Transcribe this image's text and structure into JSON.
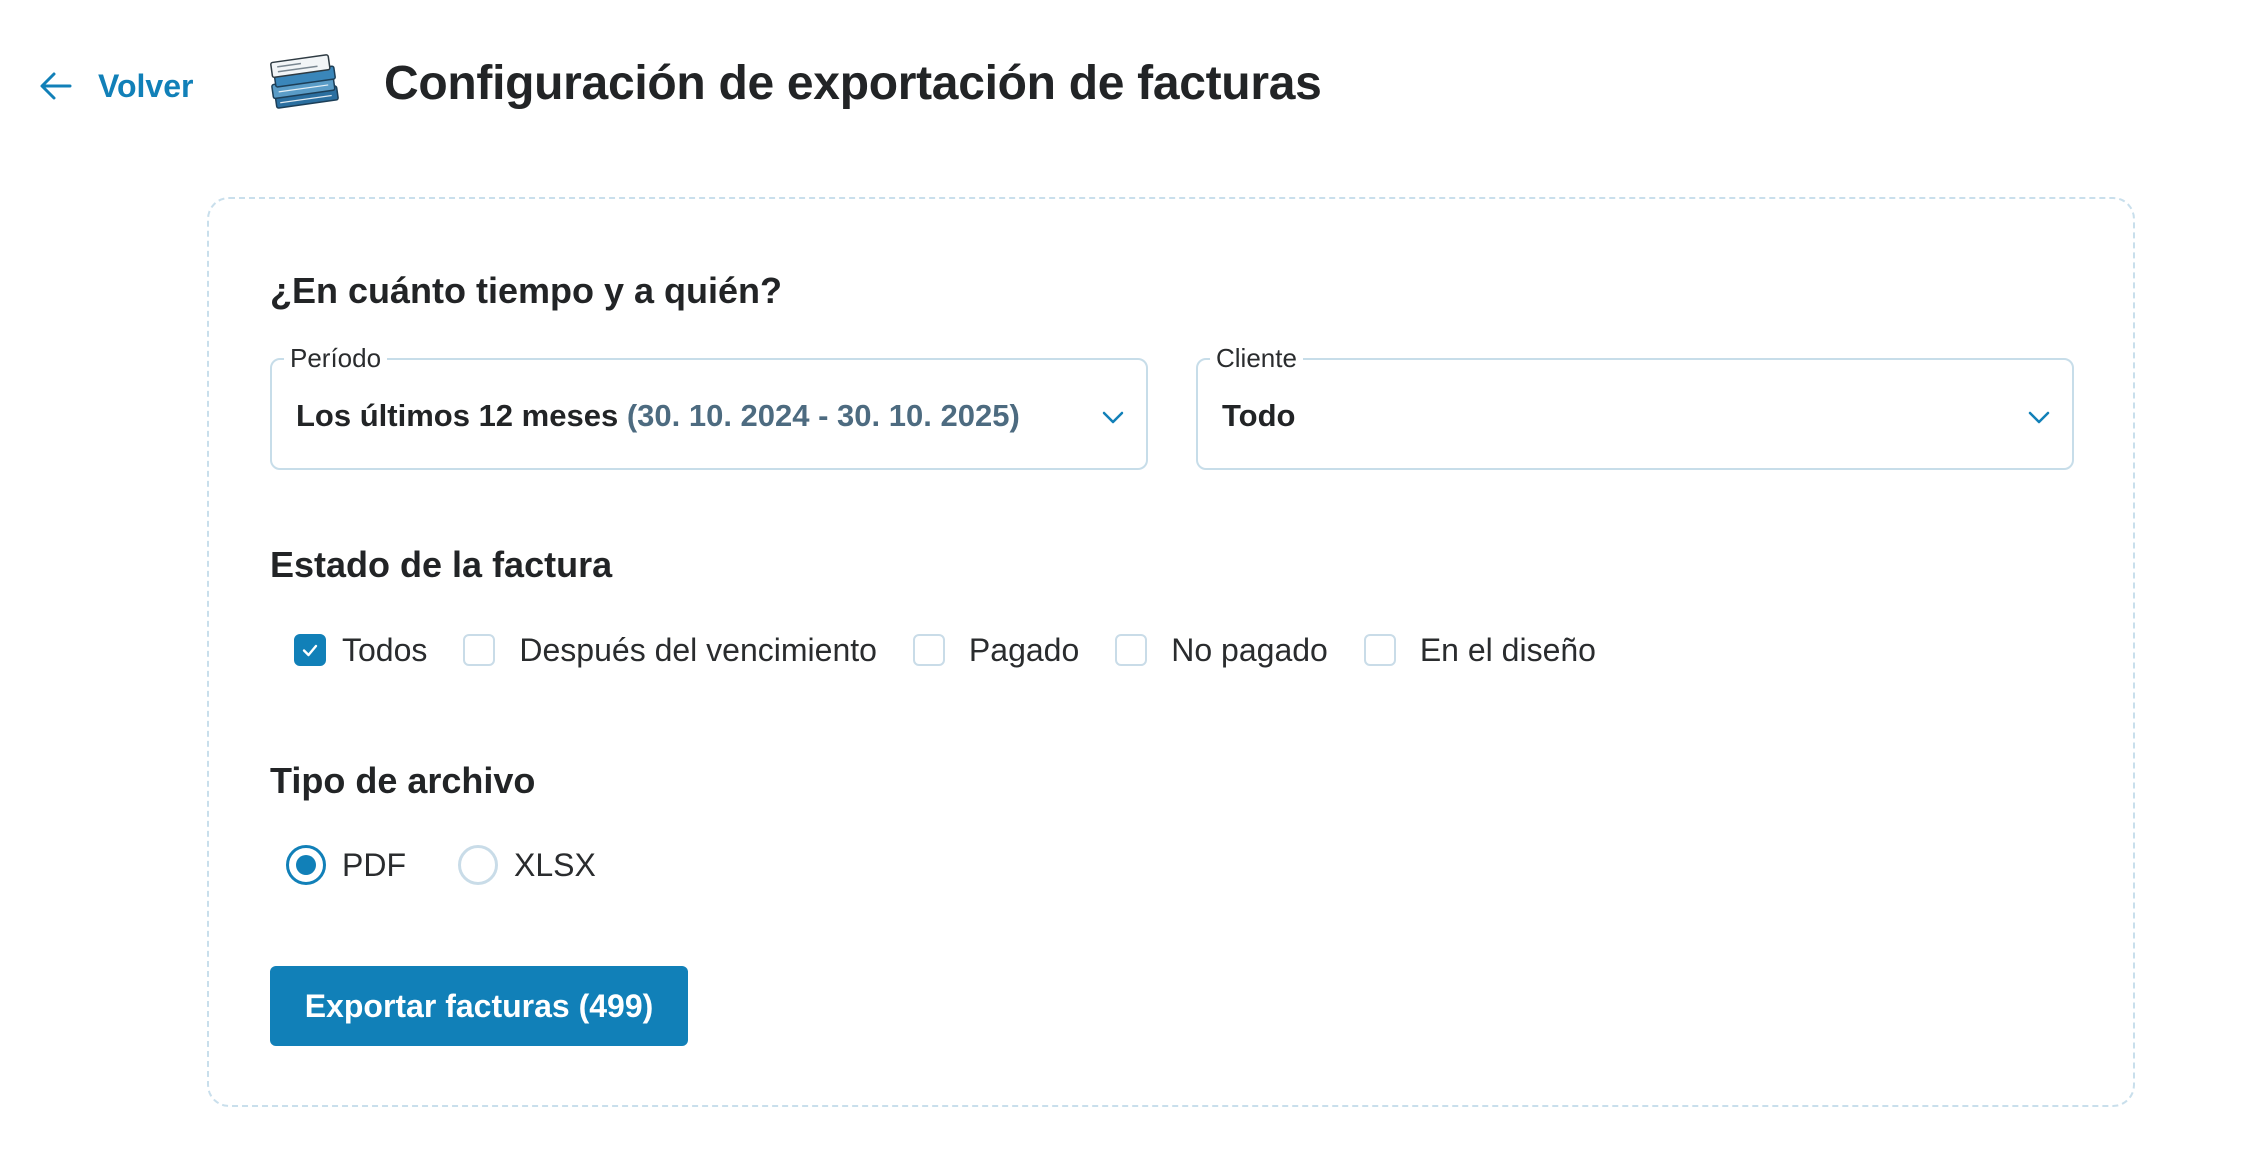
{
  "header": {
    "back_label": "Volver",
    "title": "Configuración de exportación de facturas"
  },
  "section_period": {
    "title": "¿En cuánto tiempo y a quién?"
  },
  "period_field": {
    "label": "Período",
    "value": "Los últimos 12 meses",
    "range": "(30. 10. 2024 - 30. 10. 2025)"
  },
  "client_field": {
    "label": "Cliente",
    "value": "Todo"
  },
  "section_status": {
    "title": "Estado de la factura",
    "options": [
      {
        "label": "Todos",
        "checked": true
      },
      {
        "label": "Después del vencimiento",
        "checked": false
      },
      {
        "label": "Pagado",
        "checked": false
      },
      {
        "label": "No pagado",
        "checked": false
      },
      {
        "label": "En el diseño",
        "checked": false
      }
    ]
  },
  "section_filetype": {
    "title": "Tipo de archivo",
    "options": [
      {
        "label": "PDF",
        "selected": true
      },
      {
        "label": "XLSX",
        "selected": false
      }
    ]
  },
  "export_button": {
    "label": "Exportar facturas (499)"
  },
  "colors": {
    "accent": "#1180b8",
    "border": "#c7dde9",
    "text": "#222426",
    "subtext": "#4d6b80"
  }
}
